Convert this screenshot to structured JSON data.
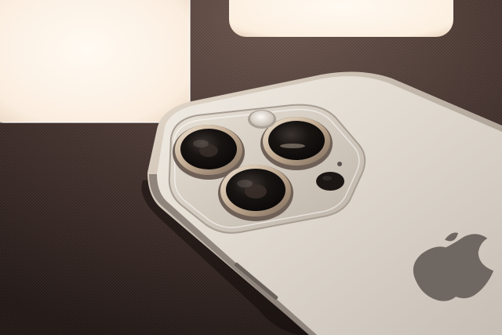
{
  "photo": {
    "subject": "iphone-back-triple-camera",
    "palette": {
      "surface_dark": "#2a1f1c",
      "surface_mid": "#4a3833",
      "surface_light": "#6d5850",
      "light_panel": "#fff6ea",
      "phone_body": "#d8d2c8",
      "phone_shadow": "#9a928a",
      "lens_ring": "#c8b39b",
      "lens_glass": "#151210",
      "logo": "#6e6660"
    }
  }
}
